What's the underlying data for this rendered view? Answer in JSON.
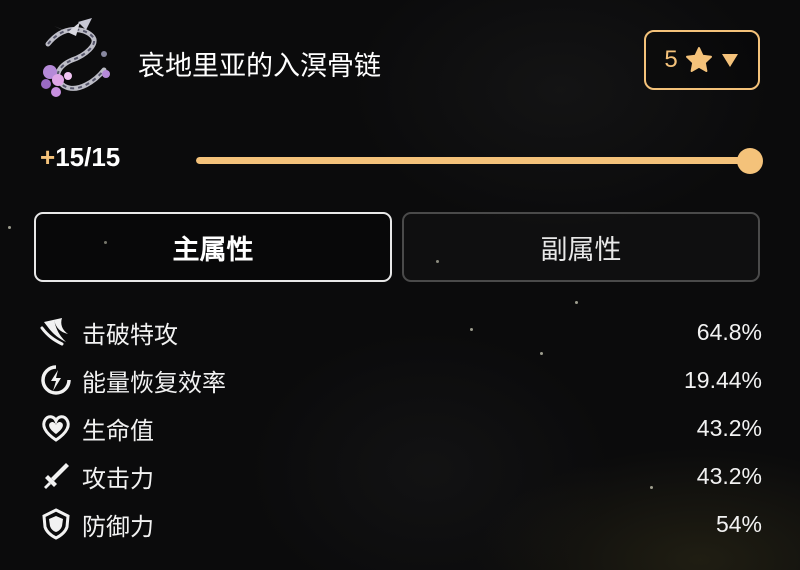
{
  "item": {
    "title": "哀地里亚的入溟骨链",
    "icon": "bone-chain-flower-icon"
  },
  "rarity": {
    "value": "5",
    "icon": "star-icon",
    "dropdown_icon": "triangle-down-icon",
    "accent": "#f4c27a"
  },
  "level": {
    "plus": "+",
    "text": "15/15",
    "current": 15,
    "max": 15
  },
  "tabs": [
    {
      "label": "主属性",
      "active": true
    },
    {
      "label": "副属性",
      "active": false
    }
  ],
  "stats": [
    {
      "icon": "break-attack-icon",
      "name": "击破特攻",
      "value": "64.8%"
    },
    {
      "icon": "energy-regen-icon",
      "name": "能量恢复效率",
      "value": "19.44%"
    },
    {
      "icon": "heart-hp-icon",
      "name": "生命值",
      "value": "43.2%"
    },
    {
      "icon": "sword-attack-icon",
      "name": "攻击力",
      "value": "43.2%"
    },
    {
      "icon": "shield-defense-icon",
      "name": "防御力",
      "value": "54%"
    }
  ]
}
